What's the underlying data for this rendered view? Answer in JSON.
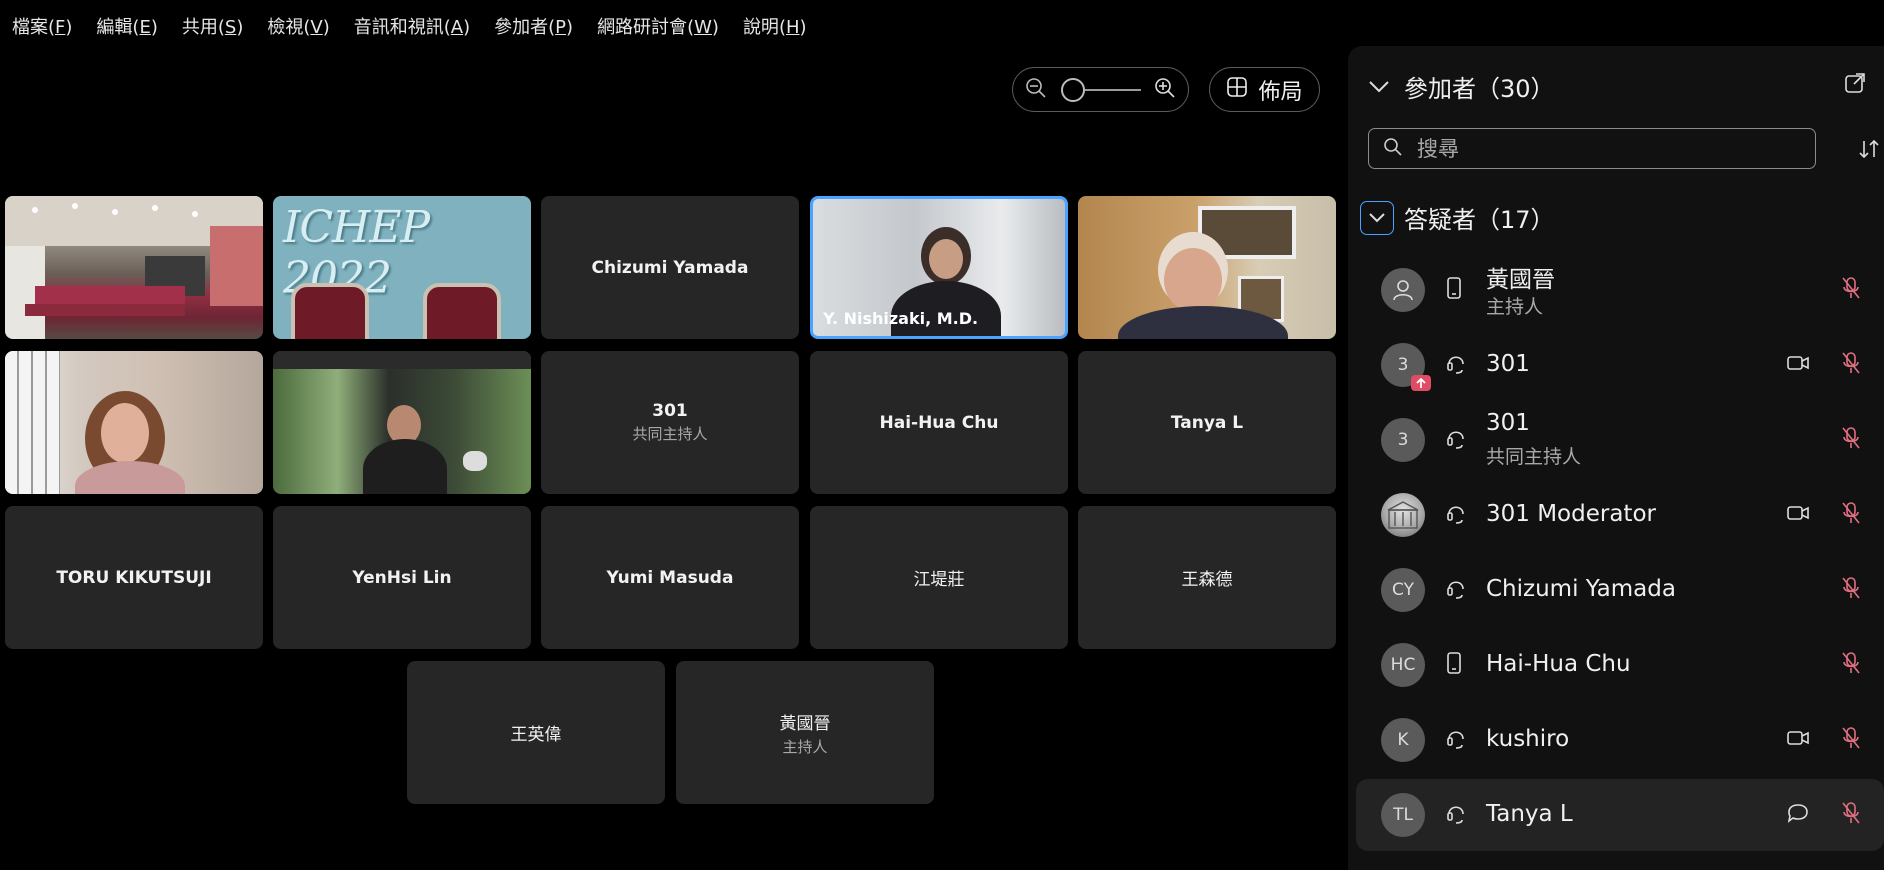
{
  "menu": [
    {
      "label": "檔案",
      "key": "F"
    },
    {
      "label": "編輯",
      "key": "E"
    },
    {
      "label": "共用",
      "key": "S"
    },
    {
      "label": "檢視",
      "key": "V"
    },
    {
      "label": "音訊和視訊",
      "key": "A"
    },
    {
      "label": "參加者",
      "key": "P"
    },
    {
      "label": "網路研討會",
      "key": "W"
    },
    {
      "label": "說明",
      "key": "H"
    }
  ],
  "toolbar": {
    "layout_label": "佈局",
    "zoom_level": 0.0
  },
  "tiles": {
    "t3": {
      "name": "Chizumi Yamada"
    },
    "t4": {
      "name": "Y. Nishizaki, M.D."
    },
    "t8": {
      "name": "301",
      "sub": "共同主持人"
    },
    "t9": {
      "name": "Hai-Hua Chu"
    },
    "t10": {
      "name": "Tanya L"
    },
    "t11": {
      "name": "TORU KIKUTSUJI"
    },
    "t12": {
      "name": "YenHsi Lin"
    },
    "t13": {
      "name": "Yumi Masuda"
    },
    "t14": {
      "name": "江堤莊"
    },
    "t15": {
      "name": "王森德"
    },
    "t16": {
      "name": "王英偉"
    },
    "t17": {
      "name": "黃國晉",
      "sub": "主持人"
    },
    "ichep_text": "ICHEP 2022"
  },
  "panel": {
    "title": "參加者（30）",
    "search_placeholder": "搜尋",
    "section_title": "答疑者（17）",
    "participants": [
      {
        "initials": "",
        "name": "黃國晉",
        "sub": "主持人",
        "device": "phone",
        "video": false,
        "chat": false
      },
      {
        "initials": "3",
        "name": "301",
        "sub": "",
        "device": "headset",
        "video": true,
        "chat": false
      },
      {
        "initials": "3",
        "name": "301",
        "sub": "共同主持人",
        "device": "headset",
        "video": false,
        "chat": false
      },
      {
        "initials": "",
        "name": "301 Moderator",
        "sub": "",
        "device": "headset",
        "video": true,
        "chat": false
      },
      {
        "initials": "CY",
        "name": "Chizumi Yamada",
        "sub": "",
        "device": "headset",
        "video": false,
        "chat": false
      },
      {
        "initials": "HC",
        "name": "Hai-Hua Chu",
        "sub": "",
        "device": "phone",
        "video": false,
        "chat": false
      },
      {
        "initials": "K",
        "name": "kushiro",
        "sub": "",
        "device": "headset",
        "video": true,
        "chat": false
      },
      {
        "initials": "TL",
        "name": "Tanya L",
        "sub": "",
        "device": "headset",
        "video": false,
        "chat": true
      }
    ]
  },
  "colors": {
    "accent": "#4aa3ff",
    "muted_mic": "#e07080",
    "tile_bg": "#262626"
  }
}
